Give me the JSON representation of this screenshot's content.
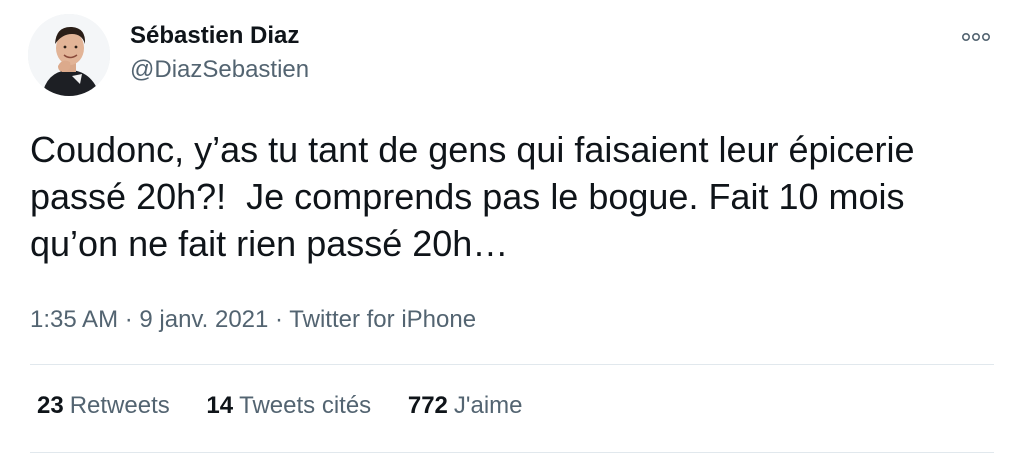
{
  "author": {
    "name": "Sébastien Diaz",
    "handle": "@DiazSebastien",
    "avatar_icon": "avatar-photo"
  },
  "more_icon": "more-options-icon",
  "tweet": {
    "lines": [
      "Coudonc, y’as tu tant de gens qui faisaient leur épicerie",
      "passé 20h?!  Je comprends pas le bogue. Fait 10 mois",
      "qu’on ne fait rien passé 20h…"
    ]
  },
  "meta": {
    "time": "1:35 AM",
    "date": "9 janv. 2021",
    "source": "Twitter for iPhone",
    "separator": " · "
  },
  "stats": [
    {
      "count": "23",
      "label": "Retweets"
    },
    {
      "count": "14",
      "label": "Tweets cités"
    },
    {
      "count": "772",
      "label": "J'aime"
    }
  ],
  "colors": {
    "text": "#0f1419",
    "secondary": "#536471",
    "divider": "#e1e8ed"
  }
}
